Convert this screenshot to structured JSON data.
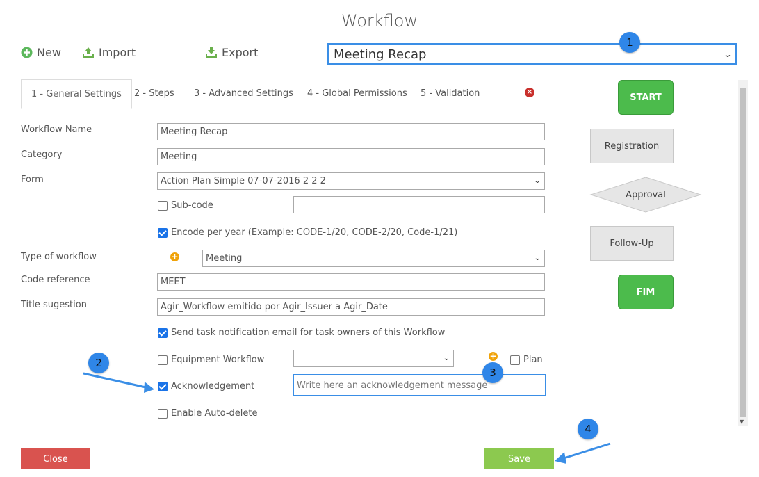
{
  "title": "Workflow",
  "toolbar": {
    "new_label": "New",
    "import_label": "Import",
    "export_label": "Export"
  },
  "workflow_select": {
    "value": "Meeting Recap"
  },
  "badges": [
    "1",
    "2",
    "3",
    "4"
  ],
  "tabs": [
    {
      "label": "1 - General Settings",
      "active": true
    },
    {
      "label": "2 - Steps"
    },
    {
      "label": "3 - Advanced Settings"
    },
    {
      "label": "4 - Global Permissions"
    },
    {
      "label": "5 - Validation"
    }
  ],
  "form": {
    "workflow_name": {
      "label": "Workflow Name",
      "value": "Meeting Recap"
    },
    "category": {
      "label": "Category",
      "value": "Meeting"
    },
    "form": {
      "label": "Form",
      "value": "Action Plan Simple 07-07-2016 2 2 2"
    },
    "subcode": {
      "label": "Sub-code",
      "checked": false,
      "value": ""
    },
    "encode_per_year": {
      "label": "Encode per year (Example: CODE-1/20, CODE-2/20, Code-1/21)",
      "checked": true
    },
    "type_of_workflow": {
      "label": "Type of workflow",
      "value": "Meeting"
    },
    "code_reference": {
      "label": "Code reference",
      "value": "MEET"
    },
    "title_suggestion": {
      "label": "Title sugestion",
      "value": "Agir_Workflow emitido por Agir_Issuer a Agir_Date"
    },
    "send_task_notification": {
      "label": "Send task notification email for task owners of this Workflow",
      "checked": true
    },
    "equipment_workflow": {
      "label": "Equipment Workflow",
      "checked": false,
      "value": ""
    },
    "plan": {
      "label": "Plan",
      "checked": false
    },
    "acknowledgement": {
      "label": "Acknowledgement",
      "checked": true,
      "placeholder": "Write here an acknowledgement message"
    },
    "auto_delete": {
      "label": "Enable Auto-delete",
      "checked": false
    }
  },
  "flow": {
    "start": "START",
    "steps": [
      "Registration",
      "Approval",
      "Follow-Up"
    ],
    "end": "FIM"
  },
  "buttons": {
    "close": "Close",
    "save": "Save"
  },
  "colors": {
    "accent_blue": "#3a8ee6",
    "badge_blue": "#2f86e8",
    "close_red": "#d9534f",
    "save_green": "#8cc94f",
    "flow_green": "#4cbb4c",
    "plus_orange": "#f0a30a",
    "new_icon_green": "#5cb85c"
  }
}
